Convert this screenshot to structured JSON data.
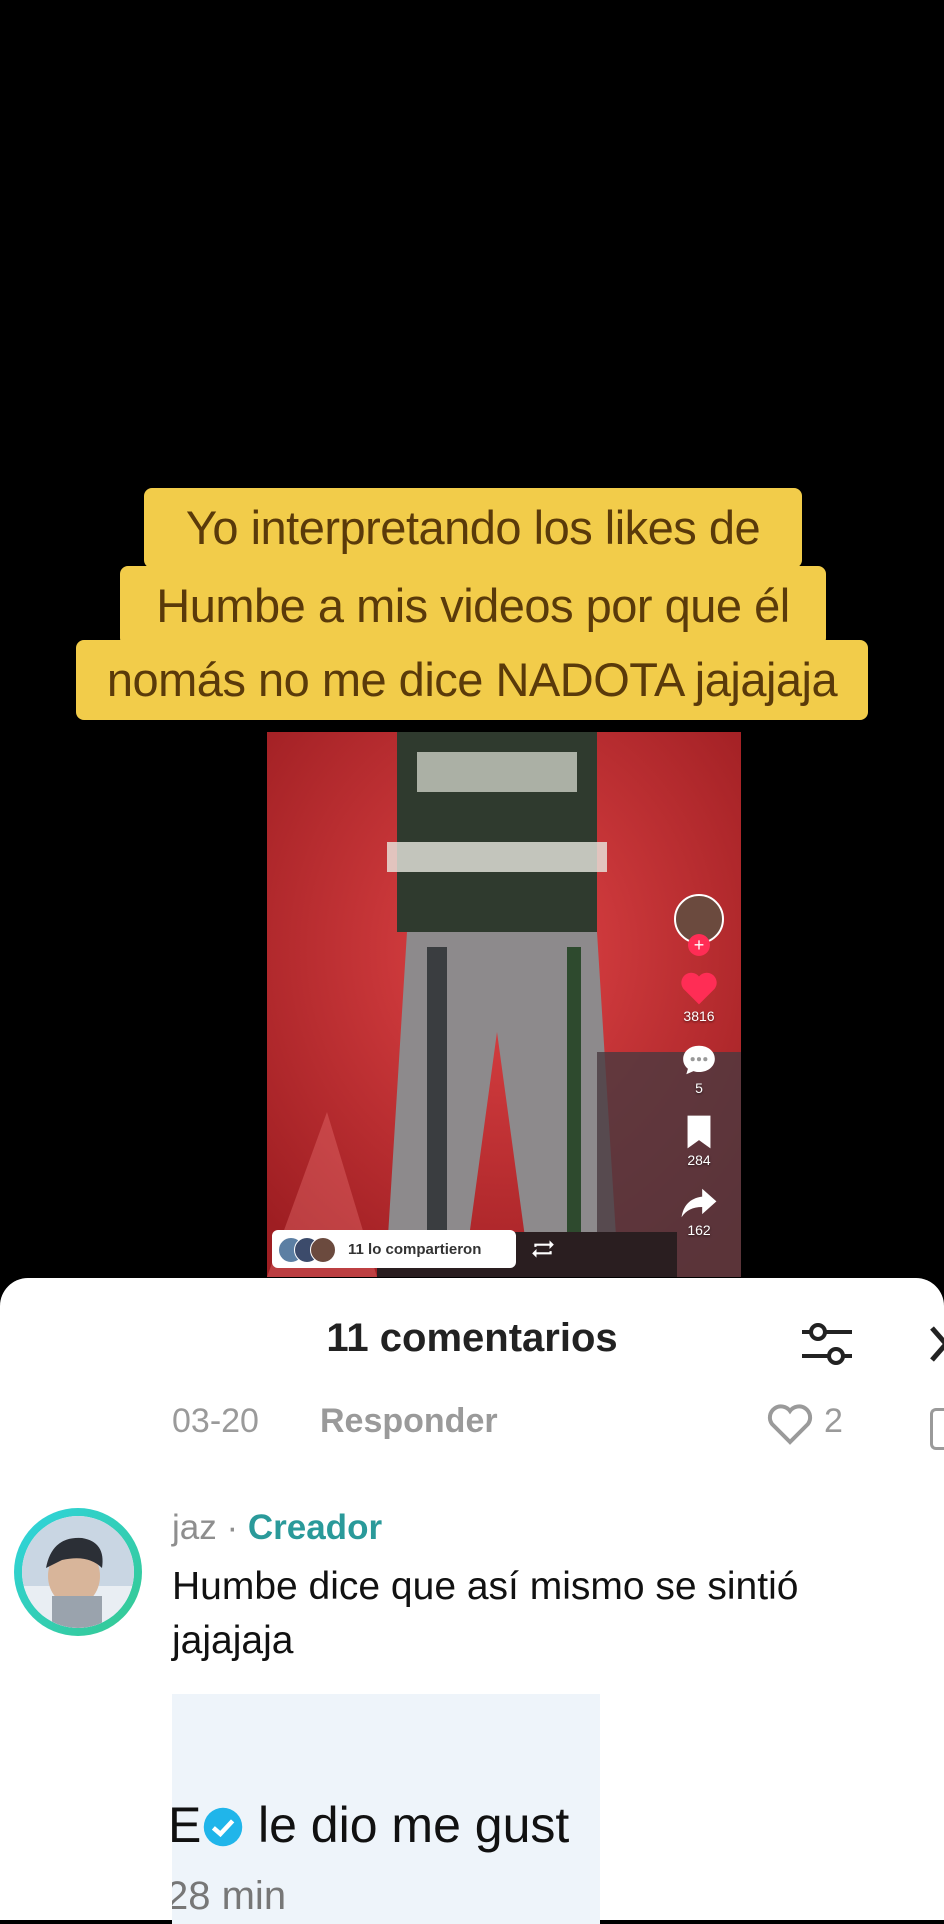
{
  "overlay_caption": {
    "line1": "Yo interpretando los likes de",
    "line2": "Humbe a mis videos por que él",
    "line3": "nomás no me dice NADOTA jajajaja"
  },
  "video": {
    "likes": "3816",
    "comments": "5",
    "saves": "284",
    "shares": "162",
    "shared_by": "11 lo compartieron"
  },
  "comments_sheet": {
    "title": "11 comentarios",
    "prev_comment": {
      "date": "03-20",
      "reply_label": "Responder",
      "likes": "2"
    },
    "comment": {
      "author": "jaz",
      "separator": " · ",
      "creator_badge": "Creador",
      "text": "Humbe dice que así mismo se sintió jajajaja"
    },
    "embedded_notification": {
      "text": "le dio me gust",
      "prefix": "E",
      "time": "28 min"
    }
  },
  "icons": [
    "add-follow-icon",
    "heart-icon",
    "comment-icon",
    "bookmark-icon",
    "share-icon",
    "repost-icon",
    "filter-icon",
    "close-icon",
    "like-outline-icon",
    "verified-icon"
  ],
  "colors": {
    "caption_bg": "#f2cc4a",
    "caption_text": "#5a3a0a",
    "creator": "#2a9a9a",
    "like": "#ff2d55"
  }
}
